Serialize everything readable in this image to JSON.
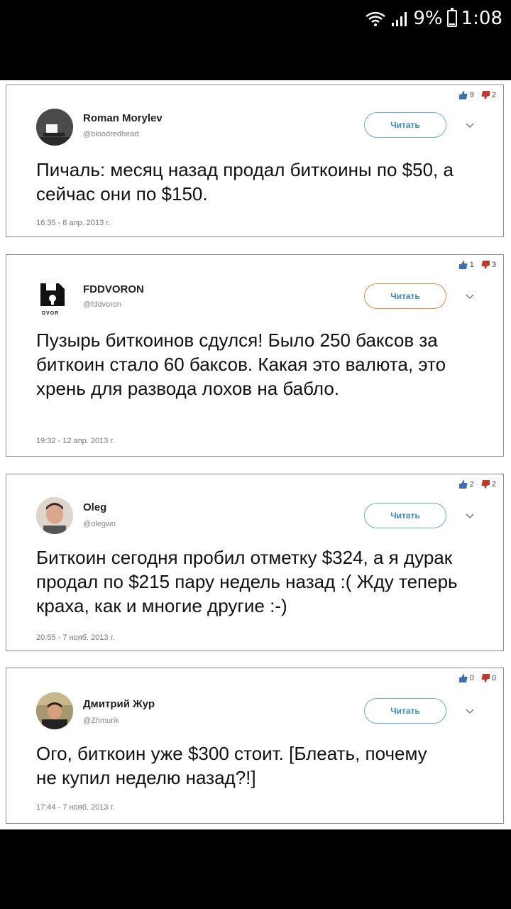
{
  "status_bar": {
    "battery": "9%",
    "time": "1:08"
  },
  "tweets": [
    {
      "author": "Roman Morylev",
      "handle": "@bloodredhead",
      "follow_label": "Читать",
      "likes": "9",
      "dislikes": "2",
      "text": "Пичаль: месяц назад продал биткоины по $50, а сейчас они по $150.",
      "date": "16:35 - 8 апр. 2013 г."
    },
    {
      "author": "FDDVORON",
      "handle": "@fddvoron",
      "follow_label": "Читать",
      "likes": "1",
      "dislikes": "3",
      "text": "Пузырь биткоинов сдулся! Было 250 баксов за биткоин стало 60 баксов. Какая это валюта, это хрень для развода лохов на бабло.",
      "date": "19:32 - 12 апр. 2013 г.",
      "avatar_caption": "DVOR"
    },
    {
      "author": "Oleg",
      "handle": "@olegwn",
      "follow_label": "Читать",
      "likes": "2",
      "dislikes": "2",
      "text": "Биткоин сегодня пробил отметку $324, а я дурак продал по $215 пару недель назад :( Жду теперь краха, как и многие другие :-)",
      "date": "20:55 - 7 нояб. 2013 г."
    },
    {
      "author": "Дмитрий Жур",
      "handle": "@Zhmurik",
      "follow_label": "Читать",
      "likes": "0",
      "dislikes": "0",
      "text": "Ого, биткоин уже $300 стоит. [Блеать, почему не купил неделю назад?!]",
      "date": "17:44 - 7 нояб. 2013 г."
    }
  ]
}
